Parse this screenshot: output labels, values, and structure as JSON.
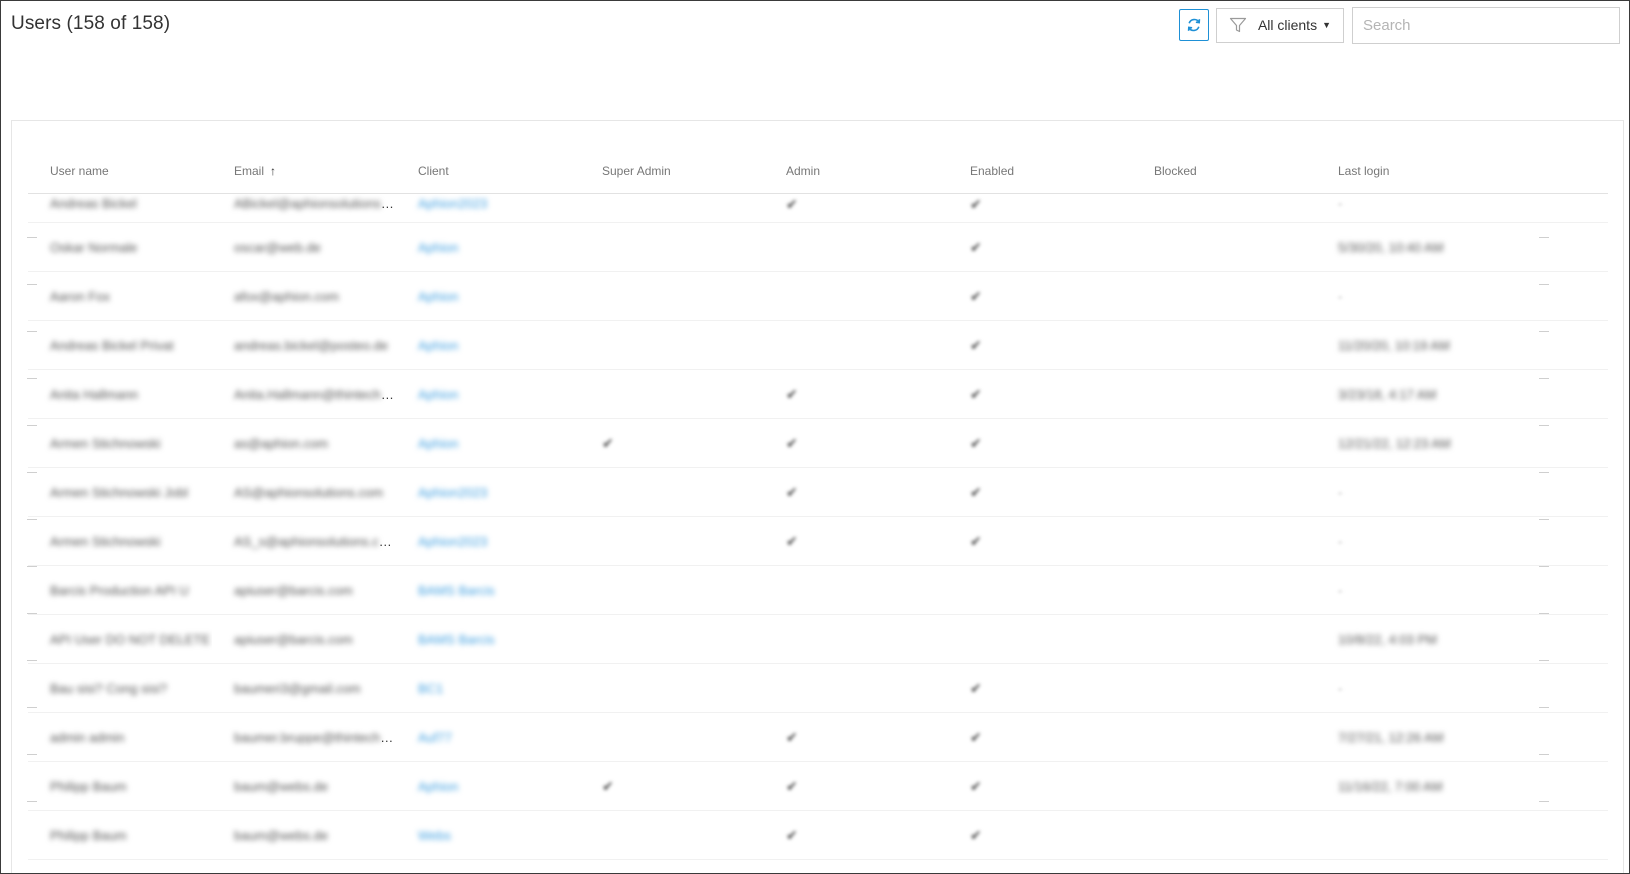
{
  "header": {
    "title": "Users (158 of 158)",
    "filter_label": "All clients",
    "search_placeholder": "Search"
  },
  "icons": {
    "refresh": "refresh-icon",
    "filter": "filter-icon",
    "caret": "caret-down-icon",
    "sort": "arrow-up-icon"
  },
  "colors": {
    "accent": "#1e90d6",
    "link": "#3f9fe0"
  },
  "table": {
    "columns": [
      "User name",
      "Email",
      "Client",
      "Super Admin",
      "Admin",
      "Enabled",
      "Blocked",
      "Last login"
    ],
    "sort_column": "Email",
    "sort_direction": "ascending",
    "rows": [
      {
        "user": "Andreas Bickel",
        "email": "ABickel@aphionsolutions.com",
        "client": "Aphion2023",
        "super_admin": false,
        "admin": true,
        "enabled": true,
        "blocked": false,
        "last_login": "-"
      },
      {
        "user": "Oskar Normale",
        "email": "oscar@web.de",
        "client": "Aphion",
        "super_admin": false,
        "admin": false,
        "enabled": true,
        "blocked": false,
        "last_login": "5/30/20, 10:40 AM"
      },
      {
        "user": "Aaron Fox",
        "email": "afox@aphion.com",
        "client": "Aphion",
        "super_admin": false,
        "admin": false,
        "enabled": true,
        "blocked": false,
        "last_login": "-"
      },
      {
        "user": "Andreas Bickel Privat",
        "email": "andreas.bickel@posteo.de",
        "client": "Aphion",
        "super_admin": false,
        "admin": false,
        "enabled": true,
        "blocked": false,
        "last_login": "11/20/20, 10:19 AM"
      },
      {
        "user": "Anita Hallmann",
        "email": "Anita.Hallmann@thintech.com",
        "client": "Aphion",
        "super_admin": false,
        "admin": true,
        "enabled": true,
        "blocked": false,
        "last_login": "3/23/18, 4:17 AM"
      },
      {
        "user": "Armen Stichnowski",
        "email": "as@aphion.com",
        "client": "Aphion",
        "super_admin": true,
        "admin": true,
        "enabled": true,
        "blocked": false,
        "last_login": "12/21/22, 12:23 AM"
      },
      {
        "user": "Armen Stichnowski Jobl",
        "email": "AS@aphionsolutions.com",
        "client": "Aphion2023",
        "super_admin": false,
        "admin": true,
        "enabled": true,
        "blocked": false,
        "last_login": "-"
      },
      {
        "user": "Armen Stichnowski",
        "email": "AS_s@aphionsolutions.com",
        "client": "Aphion2023",
        "super_admin": false,
        "admin": true,
        "enabled": true,
        "blocked": false,
        "last_login": "-"
      },
      {
        "user": "Barcis Production API U",
        "email": "apiuser@barcis.com",
        "client": "BAMS Barcis",
        "super_admin": false,
        "admin": false,
        "enabled": false,
        "blocked": false,
        "last_login": "-"
      },
      {
        "user": "API User DO NOT DELETE",
        "email": "apiuser@barcis.com",
        "client": "BAMS Barcis",
        "super_admin": false,
        "admin": false,
        "enabled": false,
        "blocked": false,
        "last_login": "10/8/22, 4:03 PM"
      },
      {
        "user": "Bau sisi? Cong sisi?",
        "email": "baumeri3@gmail.com",
        "client": "BC1",
        "super_admin": false,
        "admin": false,
        "enabled": true,
        "blocked": false,
        "last_login": "-"
      },
      {
        "user": "admin admin",
        "email": "baumer.bruppe@thintech.com",
        "client": "Auf77",
        "super_admin": false,
        "admin": true,
        "enabled": true,
        "blocked": false,
        "last_login": "7/27/21, 12:26 AM"
      },
      {
        "user": "Philipp Baum",
        "email": "baum@webs.de",
        "client": "Aphion",
        "super_admin": true,
        "admin": true,
        "enabled": true,
        "blocked": false,
        "last_login": "11/16/22, 7:00 AM"
      },
      {
        "user": "Philipp Baum",
        "email": "baum@webs.de",
        "client": "Webs",
        "super_admin": false,
        "admin": true,
        "enabled": true,
        "blocked": false,
        "last_login": ""
      }
    ]
  }
}
